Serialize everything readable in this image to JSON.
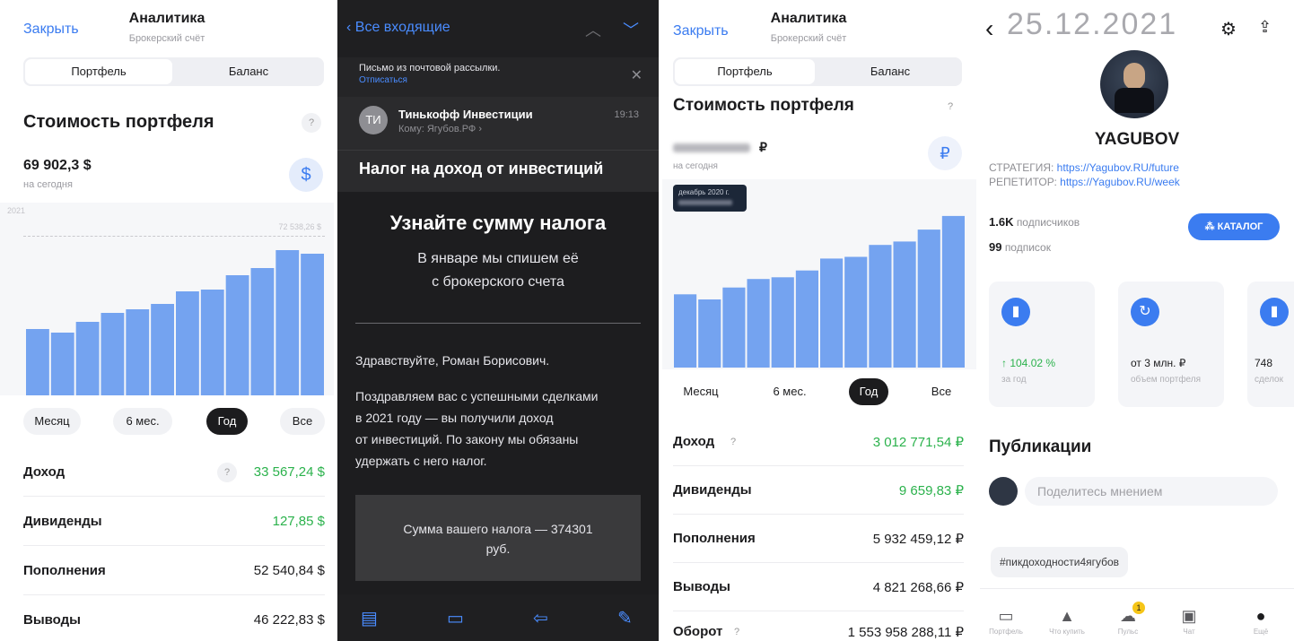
{
  "p1": {
    "close": "Закрыть",
    "title": "Аналитика",
    "subtitle": "Брокерский счёт",
    "seg": [
      "Портфель",
      "Баланс"
    ],
    "heading": "Стоимость портфеля",
    "q": "?",
    "amount": "69 902,3 $",
    "today": "на сегодня",
    "currency_icon": "$",
    "chart_year": "2021",
    "chart_max_label": "72 538,26 $",
    "periods": [
      "Месяц",
      "6 мес.",
      "Год",
      "Все"
    ],
    "rows": [
      {
        "label": "Доход",
        "q": "?",
        "value": "33 567,24 $"
      },
      {
        "label": "Дивиденды",
        "value": "127,85 $"
      },
      {
        "label": "Пополнения",
        "value": "52 540,84 $"
      },
      {
        "label": "Выводы",
        "value": "46 222,83 $"
      }
    ]
  },
  "p2": {
    "back": "‹ Все входящие",
    "notice": "Письмо из почтовой рассылки.",
    "unsubscribe": "Отписаться",
    "sender_initials": "ТИ",
    "sender": "Тинькофф Инвестиции",
    "to": "Кому: Ягубов.РФ ›",
    "time": "19:13",
    "subject": "Налог на доход от инвестиций",
    "banner": "Узнайте сумму налога",
    "banner_sub1": "В январе мы спишем её",
    "banner_sub2": "с брокерского счета",
    "greeting": "Здравствуйте, Роман Борисович.",
    "body1": "Поздравляем вас с успешными сделками",
    "body2": "в 2021 году — вы получили доход",
    "body3": "от инвестиций. По закону мы обязаны",
    "body4": "удержать с него налог.",
    "tax1": "Сумма вашего налога — 374301",
    "tax2": "руб."
  },
  "p3": {
    "close": "Закрыть",
    "title": "Аналитика",
    "subtitle": "Брокерский счёт",
    "seg": [
      "Портфель",
      "Баланс"
    ],
    "heading": "Стоимость портфеля",
    "q": "?",
    "amount_suffix": "₽",
    "today": "на сегодня",
    "currency_icon": "₽",
    "tooltip": "декабрь 2020 г.",
    "periods": [
      "Месяц",
      "6 мес.",
      "Год",
      "Все"
    ],
    "rows": [
      {
        "label": "Доход",
        "q": "?",
        "value": "3 012 771,54 ₽"
      },
      {
        "label": "Дивиденды",
        "value": "9 659,83 ₽"
      },
      {
        "label": "Пополнения",
        "value": "5 932 459,12 ₽"
      },
      {
        "label": "Выводы",
        "value": "4 821 268,66 ₽"
      },
      {
        "label": "Оборот",
        "q": "?",
        "value": "1 553 958 288,11 ₽"
      }
    ]
  },
  "p4": {
    "date": "25.12.2021",
    "name": "YAGUBOV",
    "strategy_label": "СТРАТЕГИЯ:",
    "strategy_link": "https://Yagubov.RU/future",
    "tutor_label": "РЕПЕТИТОР:",
    "tutor_link": "https://Yagubov.RU/week",
    "subs_count": "1.6K",
    "subs_label": "подписчиков",
    "following_count": "99",
    "following_label": "подписок",
    "catalog": "КАТАЛОГ",
    "stats": [
      {
        "value": "↑ 104.02 %",
        "label": "за год"
      },
      {
        "value": "от 3 млн. ₽",
        "label": "объем портфеля"
      },
      {
        "value": "748",
        "label": "сделок"
      }
    ],
    "pubs": "Публикации",
    "share": "Поделитесь мнением",
    "hashtag": "#пикдоходности4ягубов",
    "tabs": [
      "Портфель",
      "Что купить",
      "Пульс",
      "Чат",
      "Ещё"
    ],
    "pulse_badge": "1"
  },
  "chart_data": [
    {
      "type": "bar",
      "title": "",
      "values": [
        0.37,
        0.35,
        0.41,
        0.46,
        0.48,
        0.51,
        0.58,
        0.59,
        0.67,
        0.71,
        0.81,
        0.79
      ]
    },
    {
      "type": "bar",
      "title": "",
      "values": [
        0.43,
        0.4,
        0.47,
        0.52,
        0.53,
        0.57,
        0.64,
        0.65,
        0.72,
        0.74,
        0.81,
        0.89
      ]
    }
  ]
}
